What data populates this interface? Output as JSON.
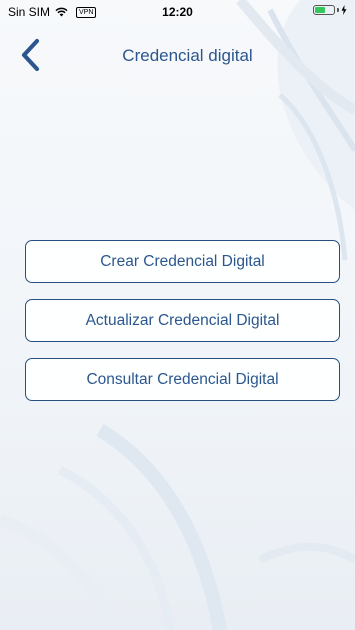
{
  "status_bar": {
    "carrier": "Sin SIM",
    "vpn": "VPN",
    "time": "12:20",
    "battery_level": 0.5,
    "battery_color": "#34c759",
    "wifi_icon": "wifi-icon",
    "charging_icon": "bolt-icon"
  },
  "nav": {
    "title": "Credencial digital",
    "back_icon": "chevron-left-icon"
  },
  "actions": [
    {
      "label": "Crear Credencial Digital"
    },
    {
      "label": "Actualizar Credencial Digital"
    },
    {
      "label": "Consultar Credencial Digital"
    }
  ],
  "colors": {
    "accent": "#2b578e",
    "button_border": "#27507f"
  }
}
